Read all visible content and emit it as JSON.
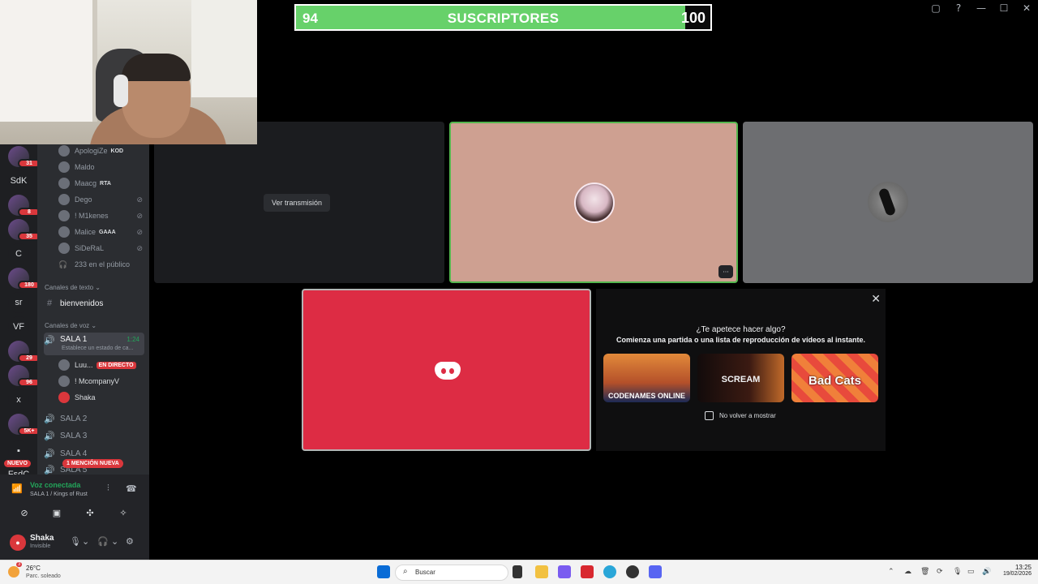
{
  "window": {
    "controls": [
      "▢",
      "?",
      "—",
      "☐",
      "✕"
    ]
  },
  "subscribers": {
    "current": "94",
    "label": "SUSCRIPTORES",
    "goal": "100",
    "progress_fraction": 0.94
  },
  "servers": [
    {
      "label": "",
      "badge": "31"
    },
    {
      "label": "SdK",
      "badge": ""
    },
    {
      "label": "",
      "badge": "8"
    },
    {
      "label": "",
      "badge": "35"
    },
    {
      "label": "C",
      "badge": ""
    },
    {
      "label": "",
      "badge": "180"
    },
    {
      "label": "sr",
      "badge": ""
    },
    {
      "label": "VF",
      "badge": ""
    },
    {
      "label": "",
      "badge": "29"
    },
    {
      "label": "",
      "badge": "96"
    },
    {
      "label": "x",
      "badge": ""
    },
    {
      "label": "",
      "badge": "5K+"
    },
    {
      "label": "▪",
      "badge": ""
    },
    {
      "label": "FsdC",
      "badge": ""
    }
  ],
  "rail": {
    "new_label": "NUEVO"
  },
  "stage_members": [
    {
      "name": "ApologiZe",
      "tag": "KOD",
      "muted": false
    },
    {
      "name": "Maldo",
      "tag": "",
      "muted": false
    },
    {
      "name": "Maacg",
      "tag": "RTA",
      "muted": false
    },
    {
      "name": "Dego",
      "tag": "",
      "muted": true
    },
    {
      "name": "! M1kenes",
      "tag": "",
      "muted": true
    },
    {
      "name": "Malice",
      "tag": "GAAA",
      "muted": true
    },
    {
      "name": "SiDeRaL",
      "tag": "",
      "muted": true
    }
  ],
  "audience": "233 en el público",
  "text_category": "Canales de texto",
  "text_channels": [
    {
      "name": "bienvenidos"
    }
  ],
  "voice_category": "Canales de voz",
  "voice_channels": {
    "sala1": {
      "name": "SALA 1",
      "time": "1:24",
      "status": "Establece un estado de ca..."
    },
    "sala1_members": [
      {
        "name": "Luu...",
        "live": "EN DIRECTO"
      },
      {
        "name": "! McompanyV",
        "live": ""
      },
      {
        "name": "Shaka",
        "live": ""
      }
    ],
    "others": [
      "SALA 2",
      "SALA 3",
      "SALA 4",
      "SALA 5"
    ]
  },
  "mention_badge": "1 MENCIÓN NUEVA",
  "voice_panel": {
    "title": "Voz conectada",
    "subtitle": "SALA 1 / Kings of Rust"
  },
  "user": {
    "name": "Shaka",
    "status": "Invisible"
  },
  "stream_tile": {
    "button": "Ver transmisión"
  },
  "activities": {
    "question": "¿Te apetece hacer algo?",
    "description": "Comienza una partida o una lista de reproducción de vídeos al instante.",
    "games": [
      {
        "name": "CODENAMES ONLINE"
      },
      {
        "name": "SCREAM"
      },
      {
        "name": "Bad Cats"
      }
    ],
    "dont_show": "No volver a mostrar"
  },
  "taskbar": {
    "weather_temp": "26°C",
    "weather_desc": "Parc. soleado",
    "weather_badge": "3",
    "search_placeholder": "Buscar",
    "time": "13:25",
    "date": "19/02/2026"
  },
  "colors": {
    "accent_green": "#23a55a",
    "progress_green": "#67d16a",
    "discord_red": "#dd2c44",
    "badge_red": "#da373c"
  }
}
